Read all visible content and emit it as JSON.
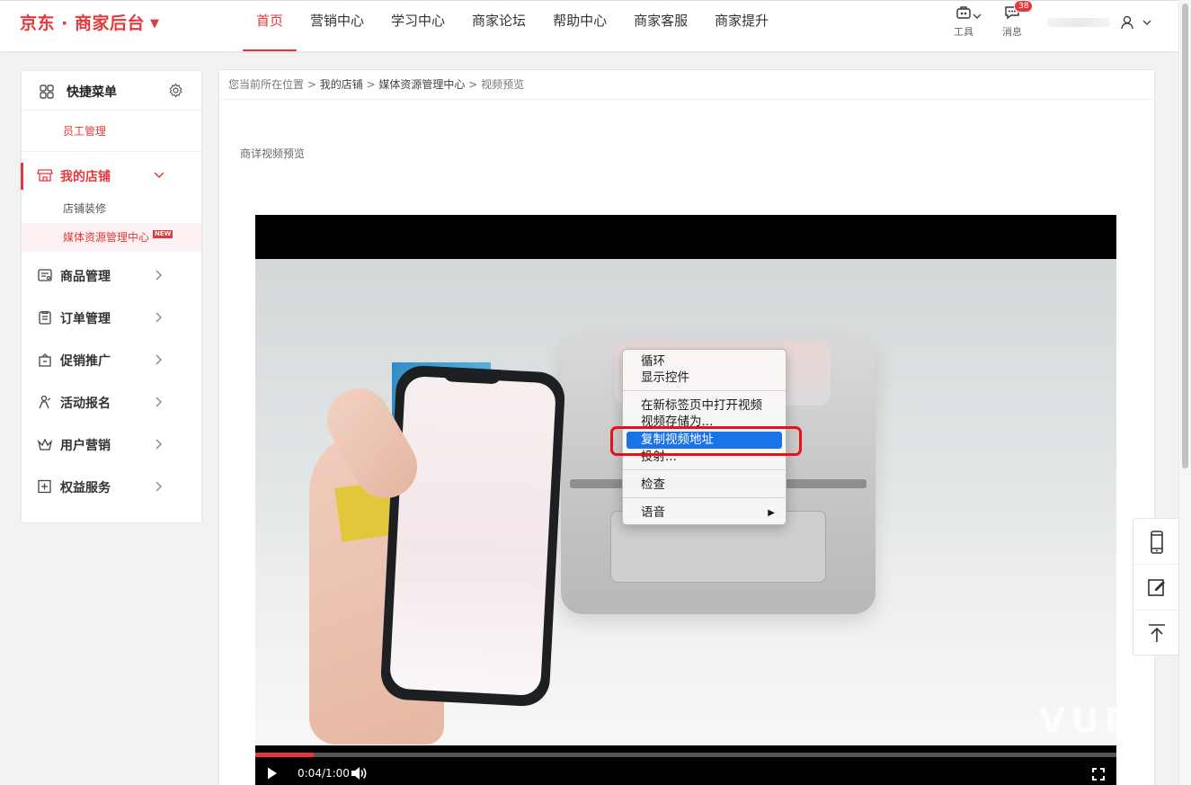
{
  "header": {
    "logo": "京东 · 商家后台",
    "logo_caret": "▼",
    "nav": [
      "首页",
      "营销中心",
      "学习中心",
      "商家论坛",
      "帮助中心",
      "商家客服",
      "商家提升"
    ],
    "active_nav": "首页",
    "tool_label": "工具",
    "message_label": "消息",
    "message_badge": "38"
  },
  "sidebar": {
    "quick_menu_title": "快捷菜单",
    "quick_items": [
      "员工管理"
    ],
    "menu": [
      {
        "label": "我的店铺",
        "icon": "store-icon",
        "expanded": true,
        "children": [
          {
            "label": "店铺装修",
            "selected": false
          },
          {
            "label": "媒体资源管理中心",
            "selected": true,
            "tag": "NEW"
          }
        ]
      },
      {
        "label": "商品管理",
        "icon": "product-icon"
      },
      {
        "label": "订单管理",
        "icon": "order-icon"
      },
      {
        "label": "促销推广",
        "icon": "promotion-icon"
      },
      {
        "label": "活动报名",
        "icon": "activity-icon"
      },
      {
        "label": "用户营销",
        "icon": "crown-icon"
      },
      {
        "label": "权益服务",
        "icon": "plus-box-icon"
      }
    ]
  },
  "breadcrumb": {
    "prefix": "您当前所在位置 > ",
    "level1": "我的店铺",
    "sep1": " > ",
    "level2": "媒体资源管理中心",
    "sep2": " > ",
    "level3": "视频预览"
  },
  "section_title": "商详视频预览",
  "video": {
    "time": "0:04/1:00",
    "progress": 0.068,
    "watermark": "VUE"
  },
  "context_menu": {
    "items": [
      "循环",
      "显示控件",
      "在新标签页中打开视频",
      "视频存储为...",
      "复制视频地址",
      "投射...",
      "检查",
      "语音"
    ],
    "highlighted": "复制视频地址",
    "submenu_arrow": "▶"
  },
  "colors": {
    "brand_red": "#e4393c",
    "highlight_blue": "#1b73e8",
    "annotation_red": "#e8101a"
  }
}
